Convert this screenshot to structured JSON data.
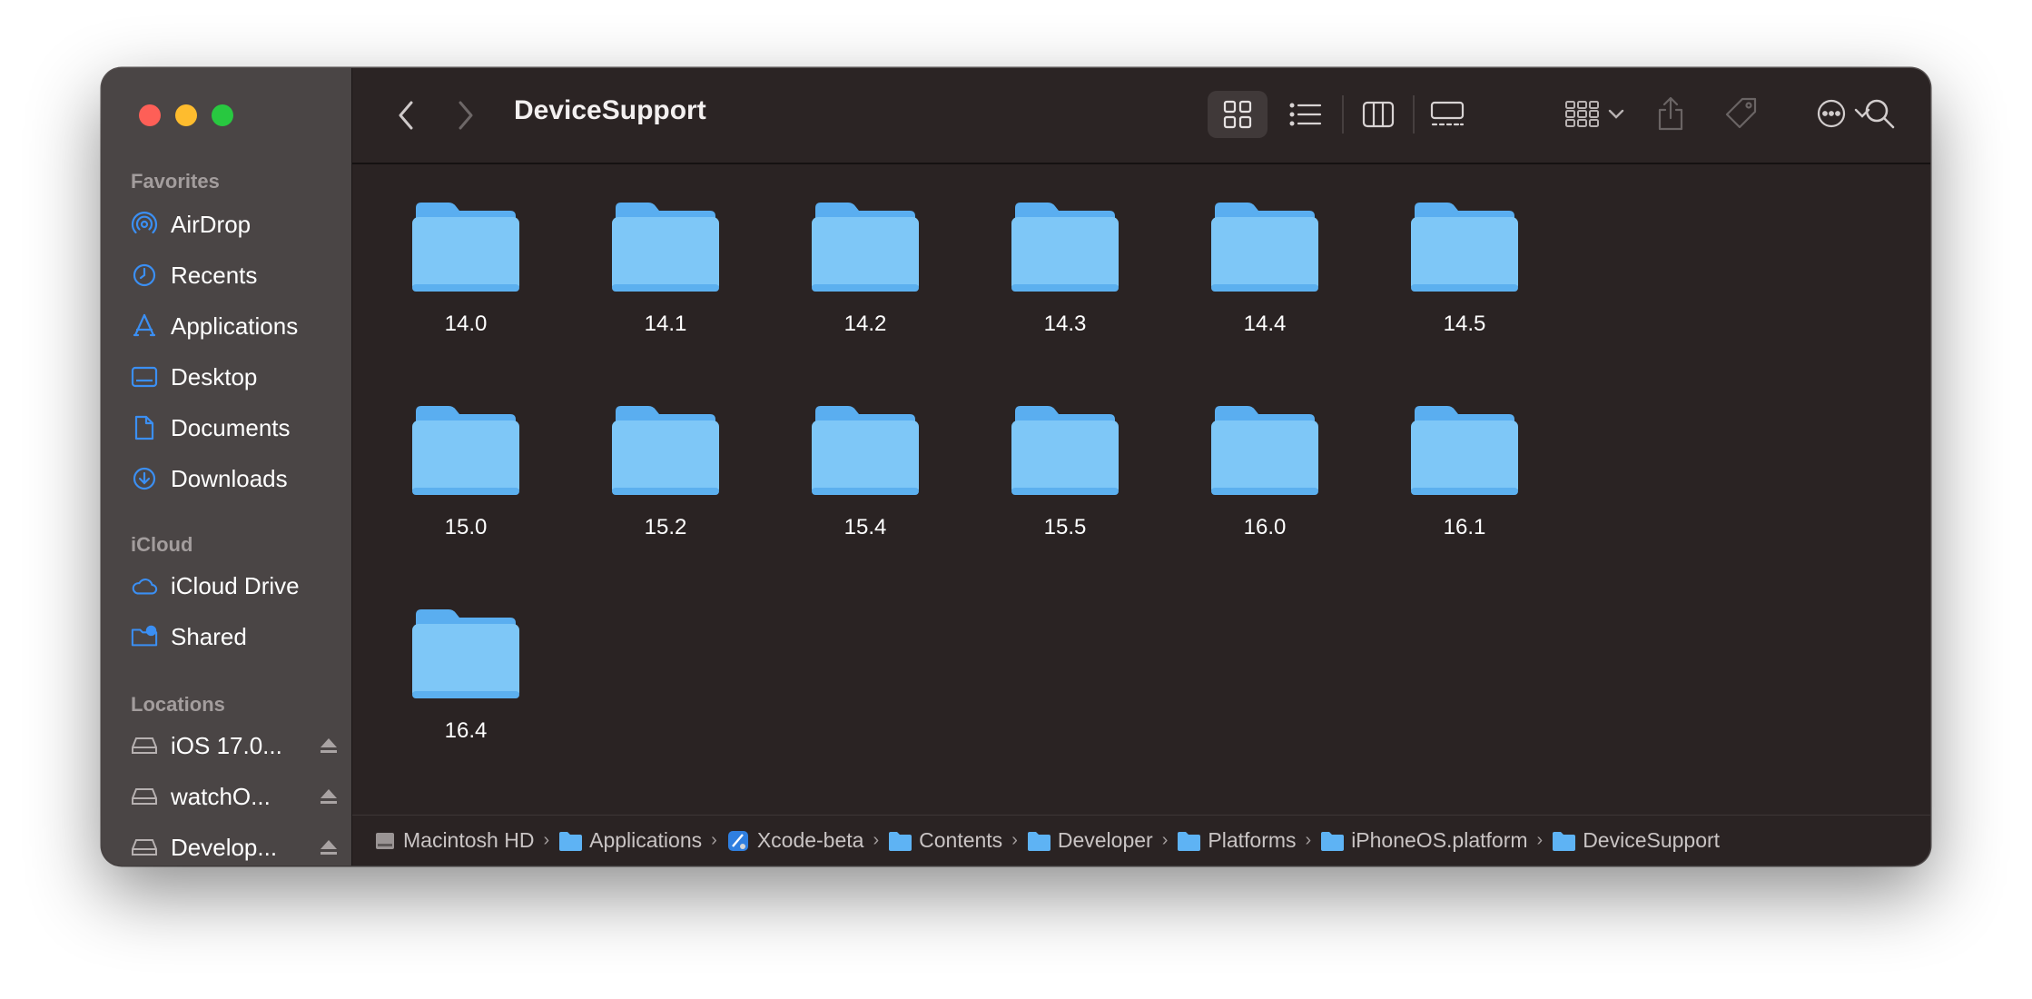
{
  "window": {
    "title": "DeviceSupport"
  },
  "sidebar": {
    "favorites_title": "Favorites",
    "favorites": [
      {
        "label": "AirDrop",
        "icon": "airdrop-icon"
      },
      {
        "label": "Recents",
        "icon": "clock-icon"
      },
      {
        "label": "Applications",
        "icon": "applications-icon"
      },
      {
        "label": "Desktop",
        "icon": "desktop-icon"
      },
      {
        "label": "Documents",
        "icon": "document-icon"
      },
      {
        "label": "Downloads",
        "icon": "download-icon"
      }
    ],
    "icloud_title": "iCloud",
    "icloud": [
      {
        "label": "iCloud Drive",
        "icon": "cloud-icon"
      },
      {
        "label": "Shared",
        "icon": "shared-folder-icon"
      }
    ],
    "locations_title": "Locations",
    "locations": [
      {
        "label": "iOS 17.0...",
        "icon": "disk-icon"
      },
      {
        "label": "watchO...",
        "icon": "disk-icon"
      },
      {
        "label": "Develop...",
        "icon": "disk-icon"
      }
    ]
  },
  "folders": [
    "14.0",
    "14.1",
    "14.2",
    "14.3",
    "14.4",
    "14.5",
    "15.0",
    "15.2",
    "15.4",
    "15.5",
    "16.0",
    "16.1",
    "16.4"
  ],
  "pathbar": [
    {
      "label": "Macintosh HD",
      "icon": "hard-drive-icon"
    },
    {
      "label": "Applications",
      "icon": "folder-icon"
    },
    {
      "label": "Xcode-beta",
      "icon": "xcode-icon"
    },
    {
      "label": "Contents",
      "icon": "folder-icon"
    },
    {
      "label": "Developer",
      "icon": "folder-icon"
    },
    {
      "label": "Platforms",
      "icon": "folder-icon"
    },
    {
      "label": "iPhoneOS.platform",
      "icon": "folder-icon"
    },
    {
      "label": "DeviceSupport",
      "icon": "folder-icon"
    }
  ],
  "colors": {
    "accent": "#3b8ff3",
    "folder": "#7ec7f7",
    "folder_tab": "#5aaef0"
  }
}
